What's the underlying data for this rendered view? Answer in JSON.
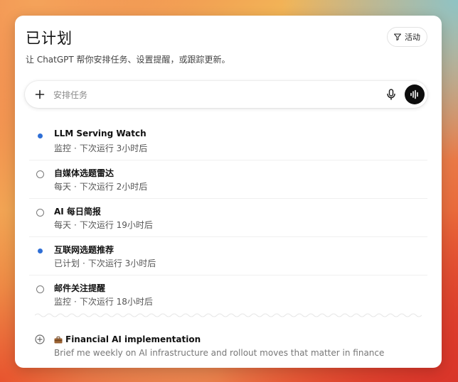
{
  "header": {
    "title": "已计划",
    "activity_label": "活动",
    "subtitle": "让 ChatGPT 帮你安排任务、设置提醒，或跟踪更新。"
  },
  "composer": {
    "placeholder": "安排任务"
  },
  "tasks": [
    {
      "title": "LLM Serving Watch",
      "frequency": "监控",
      "next_run": "下次运行 3小时后",
      "status": "active"
    },
    {
      "title": "自媒体选题雷达",
      "frequency": "每天",
      "next_run": "下次运行 2小时后",
      "status": "inactive"
    },
    {
      "title": "AI 每日简报",
      "frequency": "每天",
      "next_run": "下次运行 19小时后",
      "status": "inactive"
    },
    {
      "title": "互联网选题推荐",
      "frequency": "已计划",
      "next_run": "下次运行 3小时后",
      "status": "active"
    },
    {
      "title": "邮件关注提醒",
      "frequency": "监控",
      "next_run": "下次运行 18小时后",
      "status": "inactive"
    }
  ],
  "meta_separator": "·",
  "suggestion": {
    "title": "Financial AI implementation",
    "description": "Brief me weekly on AI infrastructure and rollout moves that matter in finance"
  },
  "colors": {
    "active_dot": "#2f6fd6",
    "voice_button": "#0d0d0d"
  },
  "icons": {
    "activity": "filter-icon",
    "composer_add": "plus-icon",
    "mic": "microphone-icon",
    "voice": "voice-waveform-icon",
    "suggestion_add": "plus-circle-icon",
    "suggestion_emoji": "briefcase-icon"
  }
}
